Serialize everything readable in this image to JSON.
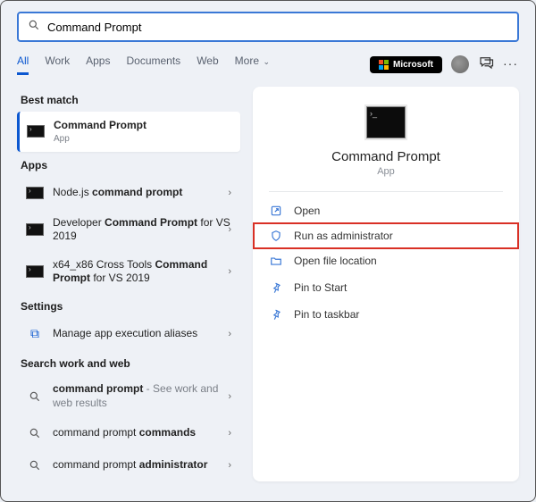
{
  "search": {
    "value": "Command Prompt"
  },
  "tabs": {
    "all": "All",
    "work": "Work",
    "apps": "Apps",
    "documents": "Documents",
    "web": "Web",
    "more": "More"
  },
  "msBadge": "Microsoft",
  "sections": {
    "bestMatch": "Best match",
    "apps": "Apps",
    "settings": "Settings",
    "searchWorkWeb": "Search work and web"
  },
  "best": {
    "title": "Command Prompt",
    "sub": "App"
  },
  "appResults": [
    {
      "prefix": "Node.js ",
      "bold": "command prompt",
      "suffix": ""
    },
    {
      "prefix": "Developer ",
      "bold": "Command Prompt",
      "suffix": " for VS 2019"
    },
    {
      "prefix": "x64_x86 Cross Tools ",
      "bold": "Command Prompt",
      "suffix": " for VS 2019"
    }
  ],
  "settingsResults": [
    {
      "label": "Manage app execution aliases"
    }
  ],
  "webResults": [
    {
      "bold": "command prompt",
      "suffix": "See work and web results",
      "sep": " - "
    },
    {
      "bold": "command prompt",
      "suffix": "commands",
      "sep": " "
    },
    {
      "bold": "command prompt",
      "suffix": "administrator",
      "sep": " "
    }
  ],
  "preview": {
    "title": "Command Prompt",
    "sub": "App"
  },
  "actions": {
    "open": "Open",
    "runAdmin": "Run as administrator",
    "openLoc": "Open file location",
    "pinStart": "Pin to Start",
    "pinTaskbar": "Pin to taskbar"
  }
}
